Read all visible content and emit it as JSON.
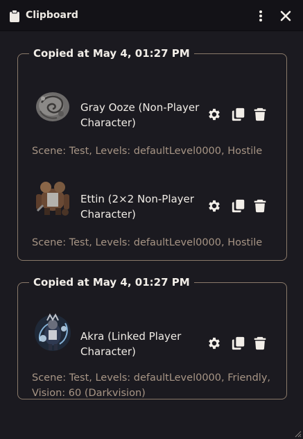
{
  "window": {
    "title": "Clipboard",
    "icon": "clipboard-icon",
    "menu_icon": "kebab-menu-icon",
    "close_icon": "close-icon"
  },
  "groups": [
    {
      "header": "Copied at May 4, 01:27 PM",
      "entries": [
        {
          "name": "Gray Ooze (Non-Player Character)",
          "meta": "Scene: Test, Levels: defaultLevel0000, Hostile",
          "portrait": "gray-ooze-portrait"
        },
        {
          "name": "Ettin (2×2 Non-Player Character)",
          "meta": "Scene: Test, Levels: defaultLevel0000, Hostile",
          "portrait": "ettin-portrait"
        }
      ]
    },
    {
      "header": "Copied at May 4, 01:27 PM",
      "entries": [
        {
          "name": "Akra (Linked Player Character)",
          "meta": "Scene: Test, Levels: defaultLevel0000, Friendly, Vision: 60 (Darkvision)",
          "portrait": "akra-portrait"
        }
      ]
    }
  ],
  "action_icons": [
    "gear-icon",
    "copy-icon",
    "trash-icon"
  ],
  "colors": {
    "background": "#1b1a20",
    "titlebar": "#131217",
    "group_border": "#8a7a6a",
    "meta_text": "#a79585",
    "primary_text": "#f0ece6"
  }
}
